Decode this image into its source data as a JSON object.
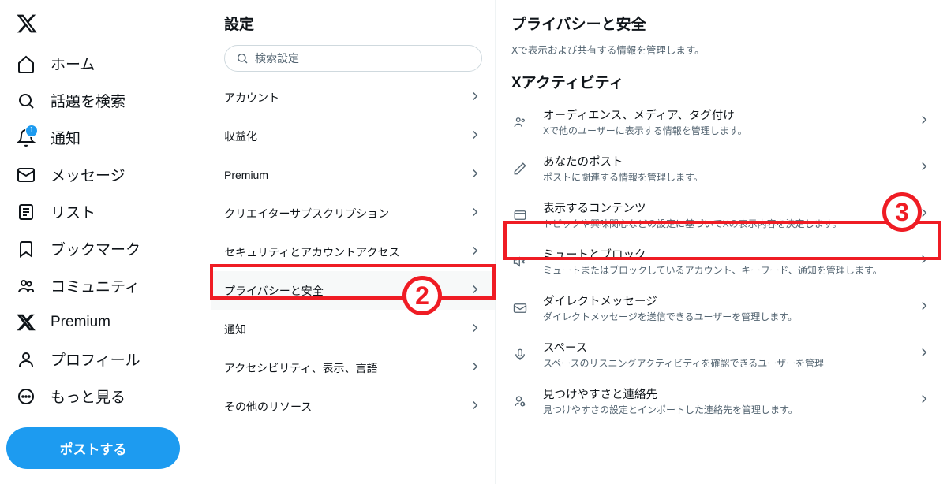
{
  "nav": {
    "items": [
      {
        "label": "ホーム"
      },
      {
        "label": "話題を検索"
      },
      {
        "label": "通知",
        "badge": "1"
      },
      {
        "label": "メッセージ"
      },
      {
        "label": "リスト"
      },
      {
        "label": "ブックマーク"
      },
      {
        "label": "コミュニティ"
      },
      {
        "label": "Premium"
      },
      {
        "label": "プロフィール"
      },
      {
        "label": "もっと見る"
      }
    ],
    "post_button": "ポストする"
  },
  "settings": {
    "title": "設定",
    "search_placeholder": "検索設定",
    "items": [
      {
        "label": "アカウント"
      },
      {
        "label": "収益化"
      },
      {
        "label": "Premium"
      },
      {
        "label": "クリエイターサブスクリプション"
      },
      {
        "label": "セキュリティとアカウントアクセス"
      },
      {
        "label": "プライバシーと安全"
      },
      {
        "label": "通知"
      },
      {
        "label": "アクセシビリティ、表示、言語"
      },
      {
        "label": "その他のリソース"
      }
    ]
  },
  "detail": {
    "title": "プライバシーと安全",
    "subtitle": "Xで表示および共有する情報を管理します。",
    "section_heading": "Xアクティビティ",
    "items": [
      {
        "title": "オーディエンス、メディア、タグ付け",
        "sub": "Xで他のユーザーに表示する情報を管理します。"
      },
      {
        "title": "あなたのポスト",
        "sub": "ポストに関連する情報を管理します。"
      },
      {
        "title": "表示するコンテンツ",
        "sub": "トピックや興味関心などの設定に基づいてXの表示内容を決定します。"
      },
      {
        "title": "ミュートとブロック",
        "sub": "ミュートまたはブロックしているアカウント、キーワード、通知を管理します。"
      },
      {
        "title": "ダイレクトメッセージ",
        "sub": "ダイレクトメッセージを送信できるユーザーを管理します。"
      },
      {
        "title": "スペース",
        "sub": "スペースのリスニングアクティビティを確認できるユーザーを管理"
      },
      {
        "title": "見つけやすさと連絡先",
        "sub": "見つけやすさの設定とインポートした連絡先を管理します。"
      }
    ]
  },
  "callouts": {
    "num2": "2",
    "num3": "3"
  }
}
